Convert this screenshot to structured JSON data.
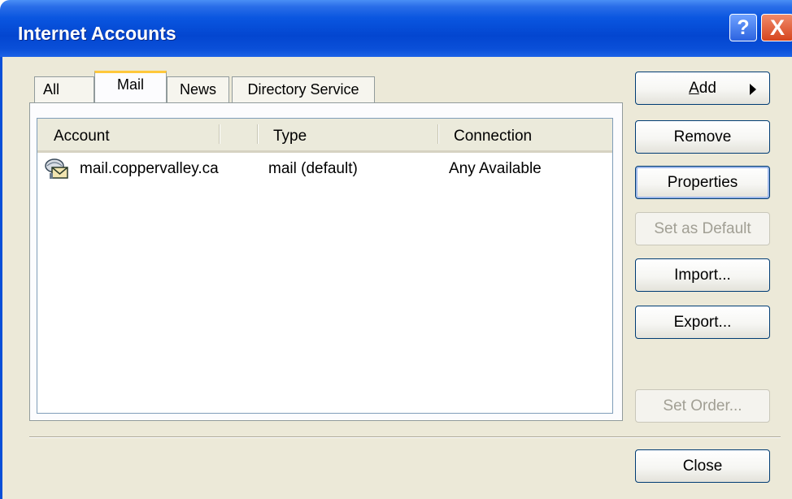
{
  "window": {
    "title": "Internet Accounts",
    "help_glyph": "?",
    "close_glyph": "X"
  },
  "tabs": [
    {
      "label": "All",
      "active": false
    },
    {
      "label": "Mail",
      "active": true
    },
    {
      "label": "News",
      "active": false
    },
    {
      "label": "Directory Service",
      "active": false
    }
  ],
  "list": {
    "columns": [
      "Account",
      "Type",
      "Connection"
    ],
    "rows": [
      {
        "account": "mail.coppervalley.ca",
        "type": "mail (default)",
        "connection": "Any Available",
        "icon": "mail-account-icon"
      }
    ]
  },
  "buttons": {
    "add_prefix": "A",
    "add_rest": "dd",
    "remove": "Remove",
    "properties": "Properties",
    "set_default": "Set as Default",
    "import": "Import...",
    "export": "Export...",
    "set_order": "Set Order...",
    "close": "Close"
  },
  "colors": {
    "titlebar": "#0a4fd8",
    "dialog_bg": "#ece9d8",
    "active_tab_accent": "#ffc83c"
  }
}
